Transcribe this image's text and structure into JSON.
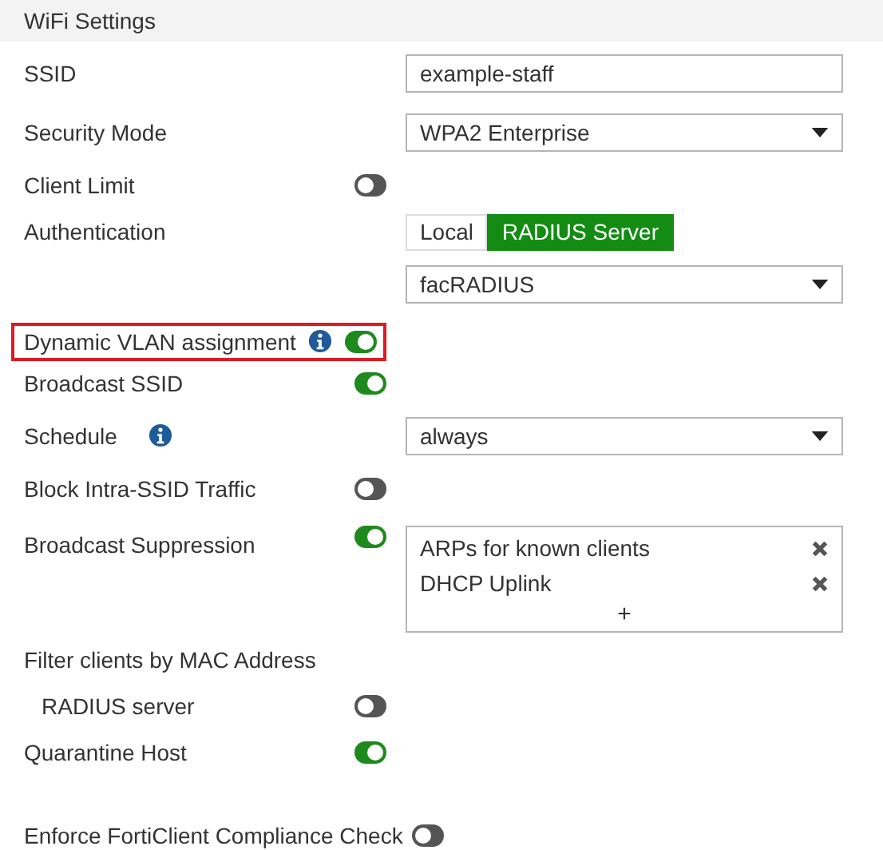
{
  "section": {
    "title": "WiFi Settings"
  },
  "rows": [
    {
      "kind": "input",
      "label": "SSID",
      "value": "example-staff"
    },
    {
      "kind": "select",
      "label": "Security Mode",
      "value": "WPA2 Enterprise"
    },
    {
      "kind": "toggle",
      "label": "Client Limit",
      "on": false
    },
    {
      "kind": "segmented",
      "label": "Authentication",
      "options": [
        {
          "label": "Local",
          "selected": false
        },
        {
          "label": "RADIUS Server",
          "selected": true
        }
      ]
    },
    {
      "kind": "select",
      "value": "facRADIUS"
    },
    {
      "kind": "toggle",
      "label": "Dynamic VLAN assignment",
      "info": true,
      "on": true,
      "highlighted": true
    },
    {
      "kind": "toggle",
      "label": "Broadcast SSID",
      "on": true
    },
    {
      "kind": "select",
      "label": "Schedule",
      "info": true,
      "value": "always"
    },
    {
      "kind": "toggle",
      "label": "Block Intra-SSID Traffic",
      "on": false
    },
    {
      "kind": "tags",
      "label": "Broadcast Suppression",
      "on": true,
      "tags": [
        "ARPs for known clients",
        "DHCP Uplink"
      ],
      "add": "+"
    },
    {
      "kind": "group",
      "label": "Filter clients by MAC Address",
      "children": [
        {
          "label": "RADIUS server",
          "on": false
        }
      ]
    },
    {
      "kind": "toggle",
      "label": "Quarantine Host",
      "on": true
    },
    {
      "kind": "inline-toggle",
      "label": "Enforce FortiClient Compliance Check",
      "on": false
    }
  ]
}
